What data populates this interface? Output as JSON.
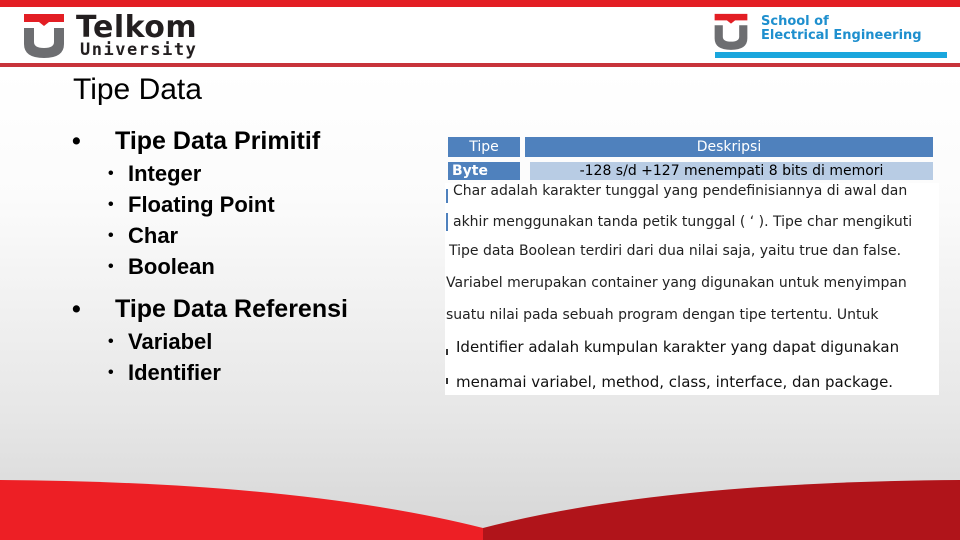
{
  "header": {
    "left_logo": {
      "name": "Telkom",
      "subtitle": "University",
      "icon": "telkom-u-icon"
    },
    "right_logo": {
      "line1": "School of",
      "line2": "Electrical Engineering",
      "icon": "telkom-u-icon"
    }
  },
  "colors": {
    "brand_red": "#e31e24",
    "dark_red": "#b0141c",
    "rule_red": "#c8333a",
    "school_blue": "#1aa6dd",
    "table_header_blue": "#4f81bd",
    "table_row_blue": "#b8cce4"
  },
  "slide": {
    "title": "Tipe Data",
    "bullets": [
      {
        "label": "Tipe Data Primitif",
        "children": [
          "Integer",
          "Floating Point",
          "Char",
          "Boolean"
        ]
      },
      {
        "label": "Tipe Data Referensi",
        "children": [
          "Variabel",
          "Identifier"
        ]
      }
    ],
    "bullet_glyph": "•"
  },
  "panel": {
    "table": {
      "headers": [
        "Tipe",
        "Deskripsi"
      ],
      "rows": [
        {
          "type": "Byte",
          "description": "-128 s/d +127 menempati 8 bits di memori"
        }
      ]
    },
    "paragraphs": [
      "Char adalah karakter tunggal yang pendefinisiannya di awal dan",
      "akhir menggunakan tanda petik tunggal ( ‘ ). Tipe char mengikuti",
      "Tipe data Boolean terdiri dari dua nilai saja, yaitu true dan false.",
      "Variabel merupakan container yang digunakan untuk menyimpan",
      "suatu nilai pada sebuah program dengan tipe tertentu. Untuk",
      "Identifier adalah kumpulan karakter yang dapat digunakan",
      "menamai variabel, method, class, interface, dan package."
    ]
  }
}
